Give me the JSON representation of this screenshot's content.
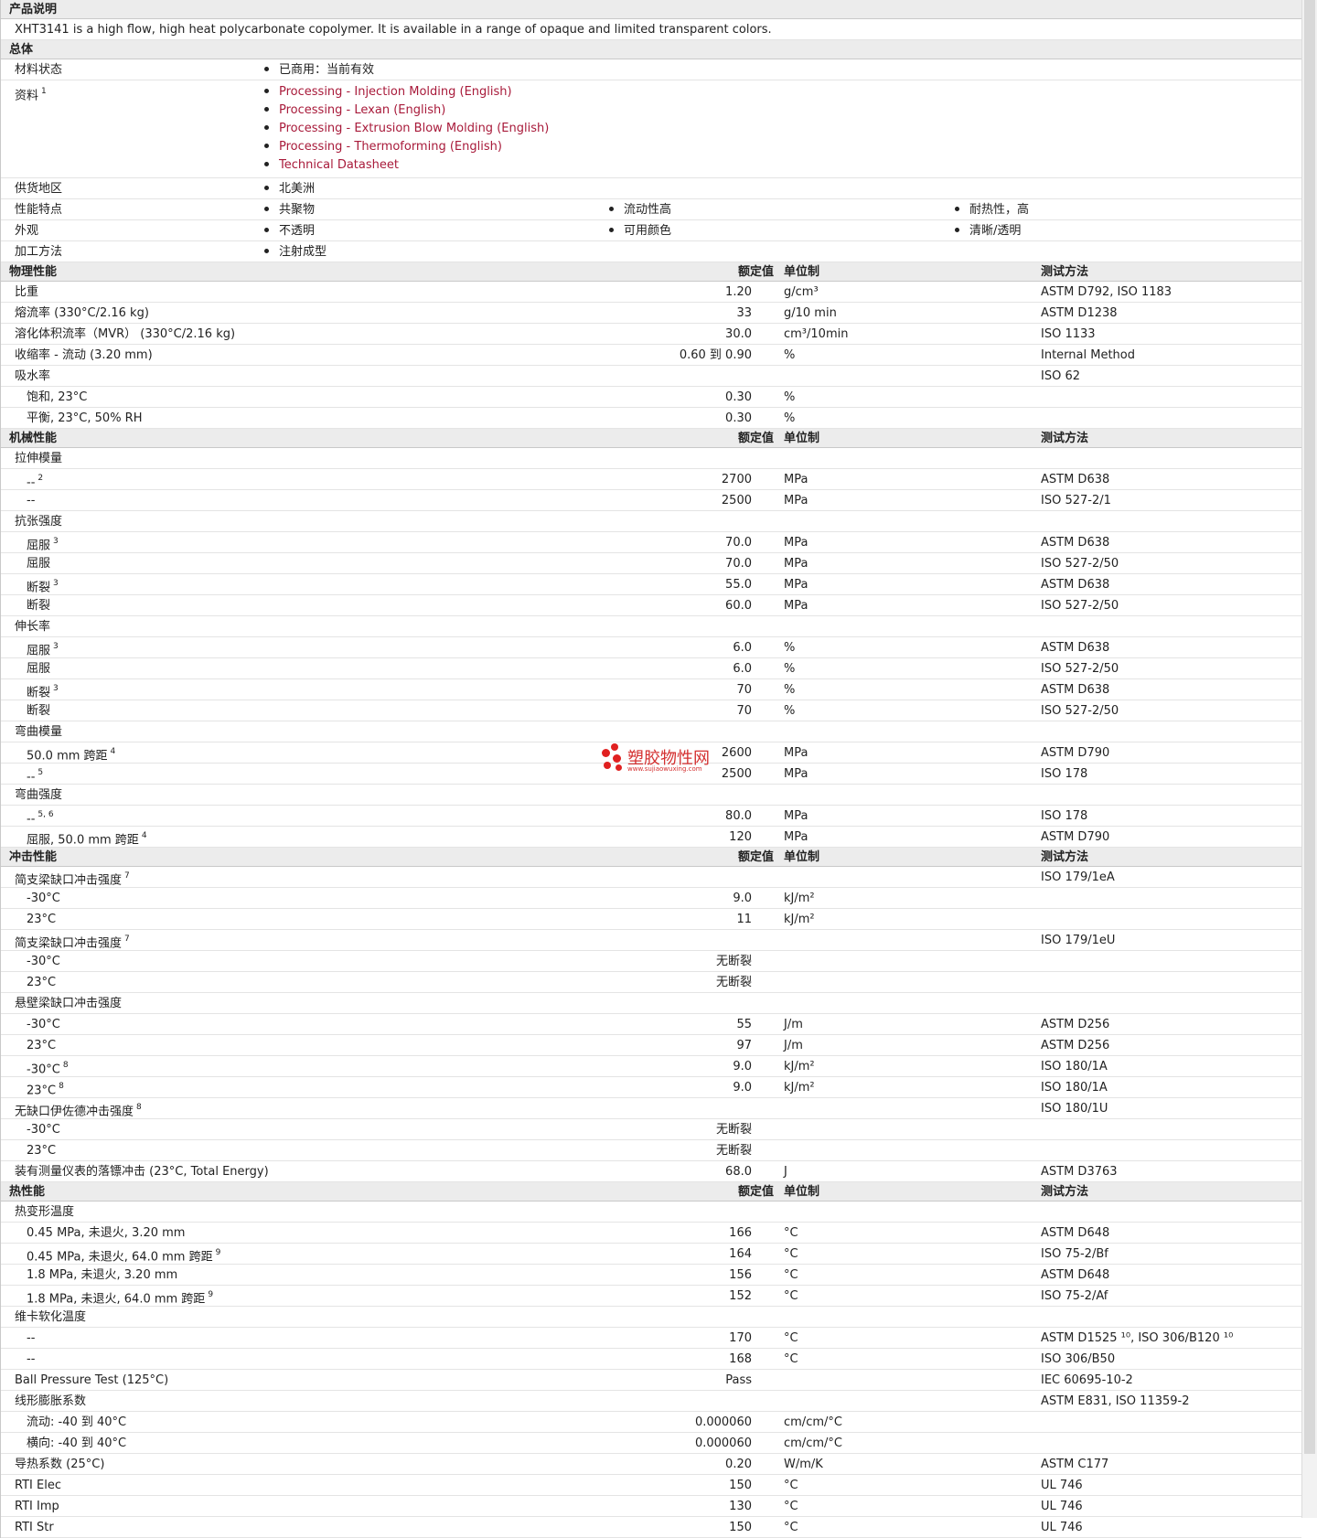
{
  "desc": {
    "title": "产品说明",
    "text": "XHT3141 is a high flow, high heat polycarbonate copolymer. It is available in a range of opaque and limited transparent colors."
  },
  "general": {
    "title": "总体",
    "status_label": "材料状态",
    "status_value": "已商用：当前有效",
    "docs_label": "资料",
    "docs_sup": "1",
    "docs": [
      "Processing - Injection Molding (English)",
      "Processing - Lexan (English)",
      "Processing - Extrusion Blow Molding (English)",
      "Processing - Thermoforming (English)",
      "Technical Datasheet"
    ],
    "region_label": "供货地区",
    "region_value": "北美洲",
    "features_label": "性能特点",
    "features": [
      "共聚物",
      "流动性高",
      "耐热性，高"
    ],
    "appearance_label": "外观",
    "appearance": [
      "不透明",
      "可用颜色",
      "清晰/透明"
    ],
    "process_label": "加工方法",
    "process_value": "注射成型"
  },
  "col_headers": {
    "value": "额定值",
    "unit": "单位制",
    "method": "测试方法"
  },
  "physical": {
    "title": "物理性能",
    "rows": [
      {
        "label": "比重",
        "value": "1.20",
        "unit": "g/cm³",
        "method": "ASTM D792, ISO 1183"
      },
      {
        "label": "熔流率 (330°C/2.16 kg)",
        "value": "33",
        "unit": "g/10 min",
        "method": "ASTM D1238"
      },
      {
        "label": "溶化体积流率（MVR） (330°C/2.16 kg)",
        "value": "30.0",
        "unit": "cm³/10min",
        "method": "ISO 1133"
      },
      {
        "label": "收缩率 - 流动 (3.20 mm)",
        "value": "0.60 到  0.90",
        "unit": "%",
        "method": "Internal Method"
      },
      {
        "label": "吸水率",
        "method": "ISO 62"
      },
      {
        "label": "饱和, 23°C",
        "sub": true,
        "value": "0.30",
        "unit": "%"
      },
      {
        "label": "平衡, 23°C, 50% RH",
        "sub": true,
        "value": "0.30",
        "unit": "%"
      }
    ]
  },
  "mechanical": {
    "title": "机械性能",
    "rows": [
      {
        "label": "拉伸模量"
      },
      {
        "label": "--",
        "sup": "2",
        "sub": true,
        "value": "2700",
        "unit": "MPa",
        "method": "ASTM D638"
      },
      {
        "label": "--",
        "sub": true,
        "value": "2500",
        "unit": "MPa",
        "method": "ISO 527-2/1"
      },
      {
        "label": "抗张强度"
      },
      {
        "label": "屈服",
        "sup": "3",
        "sub": true,
        "value": "70.0",
        "unit": "MPa",
        "method": "ASTM D638"
      },
      {
        "label": "屈服",
        "sub": true,
        "value": "70.0",
        "unit": "MPa",
        "method": "ISO 527-2/50"
      },
      {
        "label": "断裂",
        "sup": "3",
        "sub": true,
        "value": "55.0",
        "unit": "MPa",
        "method": "ASTM D638"
      },
      {
        "label": "断裂",
        "sub": true,
        "value": "60.0",
        "unit": "MPa",
        "method": "ISO 527-2/50"
      },
      {
        "label": "伸长率"
      },
      {
        "label": "屈服",
        "sup": "3",
        "sub": true,
        "value": "6.0",
        "unit": "%",
        "method": "ASTM D638"
      },
      {
        "label": "屈服",
        "sub": true,
        "value": "6.0",
        "unit": "%",
        "method": "ISO 527-2/50"
      },
      {
        "label": "断裂",
        "sup": "3",
        "sub": true,
        "value": "70",
        "unit": "%",
        "method": "ASTM D638"
      },
      {
        "label": "断裂",
        "sub": true,
        "value": "70",
        "unit": "%",
        "method": "ISO 527-2/50"
      },
      {
        "label": "弯曲模量"
      },
      {
        "label": "50.0 mm 跨距",
        "sup": "4",
        "sub": true,
        "value": "2600",
        "unit": "MPa",
        "method": "ASTM D790"
      },
      {
        "label": "--",
        "sup": "5",
        "sub": true,
        "value": "2500",
        "unit": "MPa",
        "method": "ISO 178"
      },
      {
        "label": "弯曲强度"
      },
      {
        "label": "--",
        "sup": "5, 6",
        "sub": true,
        "value": "80.0",
        "unit": "MPa",
        "method": "ISO 178"
      },
      {
        "label": "屈服, 50.0 mm 跨距",
        "sup": "4",
        "sub": true,
        "value": "120",
        "unit": "MPa",
        "method": "ASTM D790"
      }
    ]
  },
  "impact": {
    "title": "冲击性能",
    "rows": [
      {
        "label": "简支梁缺口冲击强度",
        "sup": "7",
        "method": "ISO 179/1eA"
      },
      {
        "label": "-30°C",
        "sub": true,
        "value": "9.0",
        "unit": "kJ/m²"
      },
      {
        "label": "23°C",
        "sub": true,
        "value": "11",
        "unit": "kJ/m²"
      },
      {
        "label": "简支梁缺口冲击强度",
        "sup": "7",
        "method": "ISO 179/1eU"
      },
      {
        "label": "-30°C",
        "sub": true,
        "value": "无断裂"
      },
      {
        "label": "23°C",
        "sub": true,
        "value": "无断裂"
      },
      {
        "label": "悬壁梁缺口冲击强度"
      },
      {
        "label": "-30°C",
        "sub": true,
        "value": "55",
        "unit": "J/m",
        "method": "ASTM D256"
      },
      {
        "label": "23°C",
        "sub": true,
        "value": "97",
        "unit": "J/m",
        "method": "ASTM D256"
      },
      {
        "label": "-30°C",
        "sup": "8",
        "sub": true,
        "value": "9.0",
        "unit": "kJ/m²",
        "method": "ISO 180/1A"
      },
      {
        "label": "23°C",
        "sup": "8",
        "sub": true,
        "value": "9.0",
        "unit": "kJ/m²",
        "method": "ISO 180/1A"
      },
      {
        "label": "无缺口伊佐德冲击强度",
        "sup": "8",
        "method": "ISO 180/1U"
      },
      {
        "label": "-30°C",
        "sub": true,
        "value": "无断裂"
      },
      {
        "label": "23°C",
        "sub": true,
        "value": "无断裂"
      },
      {
        "label": "装有测量仪表的落镖冲击 (23°C, Total Energy)",
        "value": "68.0",
        "unit": "J",
        "method": "ASTM D3763"
      }
    ]
  },
  "thermal": {
    "title": "热性能",
    "rows": [
      {
        "label": "热变形温度"
      },
      {
        "label": "0.45 MPa, 未退火, 3.20 mm",
        "sub": true,
        "value": "166",
        "unit": "°C",
        "method": "ASTM D648"
      },
      {
        "label": "0.45 MPa, 未退火, 64.0 mm 跨距",
        "sup": "9",
        "sub": true,
        "value": "164",
        "unit": "°C",
        "method": "ISO 75-2/Bf"
      },
      {
        "label": "1.8 MPa, 未退火, 3.20 mm",
        "sub": true,
        "value": "156",
        "unit": "°C",
        "method": "ASTM D648"
      },
      {
        "label": "1.8 MPa, 未退火, 64.0 mm 跨距",
        "sup": "9",
        "sub": true,
        "value": "152",
        "unit": "°C",
        "method": "ISO 75-2/Af"
      },
      {
        "label": "维卡软化温度"
      },
      {
        "label": "--",
        "sub": true,
        "value": "170",
        "unit": "°C",
        "method": "ASTM D1525 ¹⁰, ISO 306/B120 ¹⁰"
      },
      {
        "label": "--",
        "sub": true,
        "value": "168",
        "unit": "°C",
        "method": "ISO 306/B50"
      },
      {
        "label": "Ball Pressure Test (125°C)",
        "value": "Pass",
        "method": "IEC 60695-10-2"
      },
      {
        "label": "线形膨胀系数",
        "method": "ASTM E831, ISO 11359-2"
      },
      {
        "label": "流动: -40 到  40°C",
        "sub": true,
        "value": "0.000060",
        "unit": "cm/cm/°C"
      },
      {
        "label": "横向: -40 到  40°C",
        "sub": true,
        "value": "0.000060",
        "unit": "cm/cm/°C"
      },
      {
        "label": "导热系数 (25°C)",
        "value": "0.20",
        "unit": "W/m/K",
        "method": "ASTM C177"
      },
      {
        "label": "RTI Elec",
        "value": "150",
        "unit": "°C",
        "method": "UL 746"
      },
      {
        "label": "RTI Imp",
        "value": "130",
        "unit": "°C",
        "method": "UL 746"
      },
      {
        "label": "RTI Str",
        "value": "150",
        "unit": "°C",
        "method": "UL 746"
      }
    ]
  },
  "watermark": {
    "main": "塑胶物性网",
    "sub": "www.sujiaowuxing.com"
  },
  "colors": {
    "link": "#a81a3a",
    "header_bg": "#ececec",
    "watermark": "#d43030"
  }
}
